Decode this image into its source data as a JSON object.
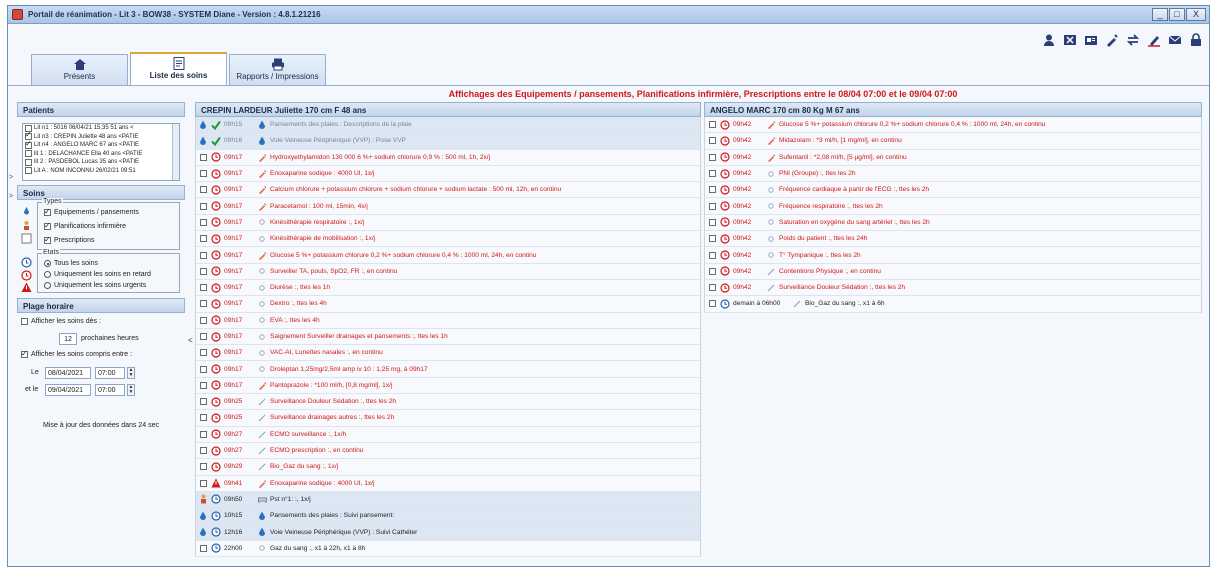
{
  "window": {
    "title": "Portail de réanimation - Lit 3 - BOW38 - SYSTEM Diane - Version : 4.8.1.21216",
    "controls": {
      "minimize": "_",
      "maximize": "□",
      "close": "X"
    }
  },
  "toolbar_icons": [
    "user-icon",
    "cancel-box-icon",
    "id-card-icon",
    "syringe-icon",
    "swap-icon",
    "pen-icon",
    "mail-icon",
    "lock-icon"
  ],
  "tabs": [
    {
      "label": "Présents",
      "icon": "home-icon"
    },
    {
      "label": "Liste des soins",
      "icon": "list-icon",
      "active": true
    },
    {
      "label": "Rapports / Impressions",
      "icon": "printer-icon"
    }
  ],
  "banner": "Affichages des Equipements / pansements, Planifications infirmière, Prescriptions entre le 08/04 07:00 et le 09/04 07:00",
  "left": {
    "patients_title": "Patients",
    "patients": [
      {
        "label": "Lit n1 : 5016 06/04/21 15:35 51 ans <",
        "checked": false
      },
      {
        "label": "Lit n3 : CREPIN Juliette 48 ans <PATIE",
        "checked": true
      },
      {
        "label": "Lit n4 : ANGELO MARC 67 ans <PATIE",
        "checked": true
      },
      {
        "label": "lit 1 : DELACHANCE Ella 40 ans <PATIE",
        "checked": false
      },
      {
        "label": "lit 2 : PASDEBOL Lucas 35 ans <PATIE",
        "checked": false
      },
      {
        "label": "Lit A : NOM INCONNU 26/02/21 09:51",
        "checked": false
      }
    ],
    "soins_title": "Soins",
    "types_legend": "Types",
    "types": [
      {
        "label": "Equipements / pansements",
        "checked": true
      },
      {
        "label": "Planifications infirmière",
        "checked": true
      },
      {
        "label": "Prescriptions",
        "checked": true
      }
    ],
    "etats_legend": "Etats",
    "etats": [
      {
        "label": "Tous les soins",
        "selected": true
      },
      {
        "label": "Uniquement les soins en retard",
        "selected": false
      },
      {
        "label": "Uniquement les soins urgents",
        "selected": false
      }
    ],
    "plage_title": "Plage horaire",
    "afficher_soins_label": "Afficher les soins dès :",
    "hours_value": "12",
    "hours_suffix": "prochaines heures",
    "afficher_compris_label": "Afficher les soins compris entre :",
    "le_label": "Le",
    "le_date": "08/04/2021",
    "le_time": "07:00",
    "etle_label": "et le",
    "etle_date": "09/04/2021",
    "etle_time": "07:00",
    "update_text": "Mise à jour des données dans 24 sec"
  },
  "patient1": {
    "header": "CREPIN LARDEUR Juliette 170 cm F 48 ans",
    "rows": [
      {
        "status": "drop",
        "icon": "check",
        "time": "09h15",
        "type": "drop",
        "text": "Pansements des plaies : Descriptions de la plaie",
        "color": "gray",
        "bg": "blue"
      },
      {
        "status": "drop",
        "icon": "check",
        "time": "09h16",
        "type": "drop",
        "text": "Voie Veineuse Périphérique (VVP) : Pose VVP",
        "color": "gray",
        "bg": "blue"
      },
      {
        "status": "cb",
        "icon": "clock-red",
        "time": "09h17",
        "type": "syringe",
        "text": "Hydroxyethylamidon 130 000 6 %+ sodium chlorure 0,9 % : 500 ml, 1h, 2x/j",
        "color": "red"
      },
      {
        "status": "cb",
        "icon": "clock-red",
        "time": "09h17",
        "type": "syringe",
        "text": "Enoxaparine sodique : 4000 UI, 1x/j",
        "color": "red"
      },
      {
        "status": "cb",
        "icon": "clock-red",
        "time": "09h17",
        "type": "syringe",
        "text": "Calcium chlorure + potassium chlorure + sodium chlorure + sodium lactate : 500 ml, 12h, en continu",
        "color": "red"
      },
      {
        "status": "cb",
        "icon": "clock-red",
        "time": "09h17",
        "type": "syringe",
        "text": "Paracetamol : 100 ml, 15min, 4x/j",
        "color": "red"
      },
      {
        "status": "cb",
        "icon": "clock-red",
        "time": "09h17",
        "type": "dot",
        "text": "Kinésithérapie respiratoire :, 1x/j",
        "color": "red"
      },
      {
        "status": "cb",
        "icon": "clock-red",
        "time": "09h17",
        "type": "dot",
        "text": "Kinésithérapie de mobilisation :, 1x/j",
        "color": "red"
      },
      {
        "status": "cb",
        "icon": "clock-red",
        "time": "09h17",
        "type": "syringe",
        "text": "Glucose 5 %+ potassium chlorure 0,2 %+ sodium chlorure 0,4 % : 1000 ml, 24h, en continu",
        "color": "red"
      },
      {
        "status": "cb",
        "icon": "clock-red",
        "time": "09h17",
        "type": "dot",
        "text": "Surveiller TA, pouls, SpO2, FR :, en continu",
        "color": "red"
      },
      {
        "status": "cb",
        "icon": "clock-red",
        "time": "09h17",
        "type": "dot",
        "text": "Diurèse :, ttes les 1h",
        "color": "red"
      },
      {
        "status": "cb",
        "icon": "clock-red",
        "time": "09h17",
        "type": "dot",
        "text": "Dextro :, ttes les 4h",
        "color": "red"
      },
      {
        "status": "cb",
        "icon": "clock-red",
        "time": "09h17",
        "type": "dot",
        "text": "EVA :, ttes les 4h",
        "color": "red"
      },
      {
        "status": "cb",
        "icon": "clock-red",
        "time": "09h17",
        "type": "dot",
        "text": "Saignement Surveiller drainages et pansements :, ttes les 1h",
        "color": "red"
      },
      {
        "status": "cb",
        "icon": "clock-red",
        "time": "09h17",
        "type": "dot",
        "text": "VAC-AI, Lunettes nasales :, en continu",
        "color": "red"
      },
      {
        "status": "cb",
        "icon": "clock-red",
        "time": "09h17",
        "type": "dot",
        "text": "Droleptan 1,25mg/2,5ml amp iv 10 : 1,25 mg, à 09h17",
        "color": "red"
      },
      {
        "status": "cb",
        "icon": "clock-red",
        "time": "09h17",
        "type": "syringe",
        "text": "Pantoprazole : *100 ml/h, [0,8 mg/ml], 1x/j",
        "color": "red"
      },
      {
        "status": "cb",
        "icon": "clock-red",
        "time": "09h25",
        "type": "pen",
        "text": "Surveillance Douleur Sédation :, ttes les 2h",
        "color": "red"
      },
      {
        "status": "cb",
        "icon": "clock-red",
        "time": "09h25",
        "type": "pen",
        "text": "Surveillance drainages autres :, ttes les 2h",
        "color": "red"
      },
      {
        "status": "cb",
        "icon": "clock-red",
        "time": "09h27",
        "type": "pen",
        "text": "ECMO surveillance :, 1x/h",
        "color": "red"
      },
      {
        "status": "cb",
        "icon": "clock-red",
        "time": "09h27",
        "type": "pen",
        "text": "ECMO prescription :, en continu",
        "color": "red"
      },
      {
        "status": "cb",
        "icon": "clock-red",
        "time": "09h29",
        "type": "pen",
        "text": "Bio_Gaz du sang :, 1x/j",
        "color": "red"
      },
      {
        "status": "cb",
        "icon": "alert",
        "time": "09h41",
        "type": "syringe",
        "text": "Enoxaparine sodique : 4000 UI, 1x/j",
        "color": "red"
      },
      {
        "status": "person",
        "icon": "clock-blue",
        "time": "09h50",
        "type": "bed",
        "text": "Pst n°1: :, 1x/j",
        "color": "dark",
        "bg": "blue"
      },
      {
        "status": "drop",
        "icon": "clock-blue",
        "time": "10h15",
        "type": "drop",
        "text": "Pansements des plaies : Suivi pansement:",
        "color": "dark",
        "bg": "blue"
      },
      {
        "status": "drop",
        "icon": "clock-blue",
        "time": "12h16",
        "type": "drop",
        "text": "Voie Veineuse Périphérique (VVP) : Suivi Cathéter",
        "color": "dark",
        "bg": "blue"
      },
      {
        "status": "cb",
        "icon": "clock-blue",
        "time": "22h00",
        "type": "dot",
        "text": "Gaz du sang :, x1 à 22h, x1 à 8h",
        "color": "dark"
      }
    ]
  },
  "patient2": {
    "header": "ANGELO MARC 170 cm 80 Kg M 67 ans",
    "rows": [
      {
        "status": "cb",
        "icon": "clock-red",
        "time": "09h42",
        "type": "syringe",
        "text": "Glucose 5 %+ potassium chlorure 0,2 %+ sodium chlorure 0,4 % : 1000 ml, 24h, en continu",
        "color": "red"
      },
      {
        "status": "cb",
        "icon": "clock-red",
        "time": "09h42",
        "type": "syringe",
        "text": "Midazolam : *3 ml/h, [1 mg/ml], en continu",
        "color": "red"
      },
      {
        "status": "cb",
        "icon": "clock-red",
        "time": "09h42",
        "type": "syringe",
        "text": "Sufentanil : *2,08 ml/h, [5 µg/ml], en continu",
        "color": "red"
      },
      {
        "status": "cb",
        "icon": "clock-red",
        "time": "09h42",
        "type": "dot",
        "text": "PNI (Groupe) :, ttes les 2h",
        "color": "red"
      },
      {
        "status": "cb",
        "icon": "clock-red",
        "time": "09h42",
        "type": "dot",
        "text": "Fréquence cardiaque à partir de l'ECG :, ttes les 2h",
        "color": "red"
      },
      {
        "status": "cb",
        "icon": "clock-red",
        "time": "09h42",
        "type": "dot",
        "text": "Fréquence respiratoire :, ttes les 2h",
        "color": "red"
      },
      {
        "status": "cb",
        "icon": "clock-red",
        "time": "09h42",
        "type": "dot",
        "text": "Saturation en oxygène du sang artériel :, ttes les 2h",
        "color": "red"
      },
      {
        "status": "cb",
        "icon": "clock-red",
        "time": "09h42",
        "type": "dot",
        "text": "Poids du patient :, ttes les 24h",
        "color": "red"
      },
      {
        "status": "cb",
        "icon": "clock-red",
        "time": "09h42",
        "type": "dot",
        "text": "T° Tympanique :, ttes les 2h",
        "color": "red"
      },
      {
        "status": "cb",
        "icon": "clock-red",
        "time": "09h42",
        "type": "pen",
        "text": "Contentions Physique :, en continu",
        "color": "red"
      },
      {
        "status": "cb",
        "icon": "clock-red",
        "time": "09h42",
        "type": "pen",
        "text": "Surveillance Douleur Sédation :, ttes les 2h",
        "color": "red"
      },
      {
        "status": "cb",
        "icon": "clock-blue",
        "time": "demain à 06h00",
        "type": "pen",
        "text": "Bio_Gaz du sang :, x1 à 6h",
        "color": "dark"
      }
    ]
  }
}
